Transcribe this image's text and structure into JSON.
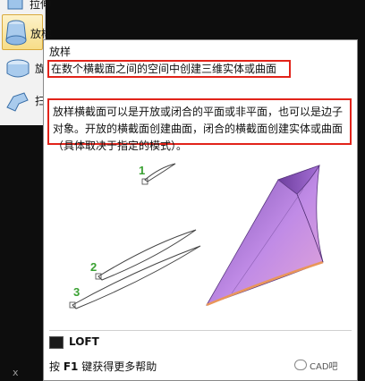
{
  "ribbon": {
    "top_label": "拉伸",
    "active_label": "放样",
    "item3_label": "旋",
    "item4_label": "扫"
  },
  "tooltip": {
    "title": "放样",
    "short_desc": "在数个横截面之间的空间中创建三维实体或曲面",
    "long_desc": "放样横截面可以是开放或闭合的平面或非平面，也可以是边子对象。开放的横截面创建曲面，闭合的横截面创建实体或曲面（具体取决于指定的模式）。",
    "illustration_labels": [
      "1",
      "2",
      "3"
    ],
    "command_name": "LOFT",
    "help_prefix": "按 ",
    "help_key": "F1",
    "help_suffix": " 键获得更多帮助"
  },
  "watermark": {
    "text": "CAD吧",
    "icon": "wechat-icon"
  },
  "corner_mark": "x",
  "colors": {
    "highlight_border": "#e2231a",
    "active_button": "#f7dd88",
    "surface_fill": "#b07be0",
    "surface_edge": "#e9965a",
    "label_green": "#3aa132"
  }
}
